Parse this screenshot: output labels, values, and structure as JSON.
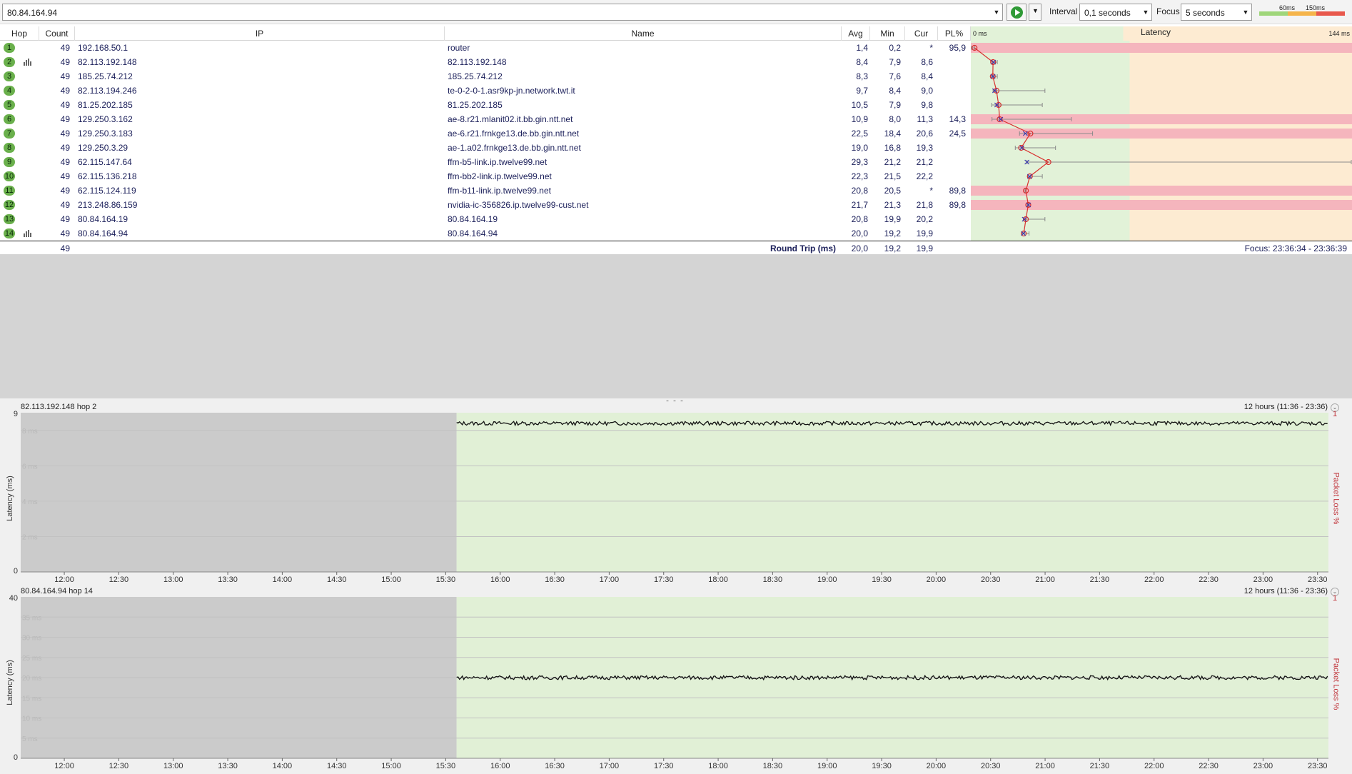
{
  "toolbar": {
    "target": "80.84.164.94",
    "interval_label": "Interval",
    "interval_value": "0,1 seconds",
    "focus_label": "Focus",
    "focus_value": "5 seconds",
    "scale_labels": [
      "60ms",
      "150ms"
    ],
    "colors": {
      "good": "#9fd67a",
      "warn": "#f5b44a",
      "bad": "#e8584c"
    }
  },
  "table": {
    "headers": {
      "hop": "Hop",
      "count": "Count",
      "ip": "IP",
      "name": "Name",
      "avg": "Avg",
      "min": "Min",
      "cur": "Cur",
      "pl": "PL%",
      "latency": "Latency"
    },
    "latency_scale": {
      "min_label": "0 ms",
      "max_label": "144 ms"
    },
    "rows": [
      {
        "hop": "1",
        "count": "49",
        "ip": "192.168.50.1",
        "name": "router",
        "avg": "1,4",
        "min": "0,2",
        "cur": "*",
        "pl": "95,9",
        "graph": false
      },
      {
        "hop": "2",
        "count": "49",
        "ip": "82.113.192.148",
        "name": "82.113.192.148",
        "avg": "8,4",
        "min": "7,9",
        "cur": "8,6",
        "pl": "",
        "graph": true
      },
      {
        "hop": "3",
        "count": "49",
        "ip": "185.25.74.212",
        "name": "185.25.74.212",
        "avg": "8,3",
        "min": "7,6",
        "cur": "8,4",
        "pl": "",
        "graph": false
      },
      {
        "hop": "4",
        "count": "49",
        "ip": "82.113.194.246",
        "name": "te-0-2-0-1.asr9kp-jn.network.twt.it",
        "avg": "9,7",
        "min": "8,4",
        "cur": "9,0",
        "pl": "",
        "graph": false
      },
      {
        "hop": "5",
        "count": "49",
        "ip": "81.25.202.185",
        "name": "81.25.202.185",
        "avg": "10,5",
        "min": "7,9",
        "cur": "9,8",
        "pl": "",
        "graph": false
      },
      {
        "hop": "6",
        "count": "49",
        "ip": "129.250.3.162",
        "name": "ae-8.r21.mlanit02.it.bb.gin.ntt.net",
        "avg": "10,9",
        "min": "8,0",
        "cur": "11,3",
        "pl": "14,3",
        "graph": false
      },
      {
        "hop": "7",
        "count": "49",
        "ip": "129.250.3.183",
        "name": "ae-6.r21.frnkge13.de.bb.gin.ntt.net",
        "avg": "22,5",
        "min": "18,4",
        "cur": "20,6",
        "pl": "24,5",
        "graph": false
      },
      {
        "hop": "8",
        "count": "49",
        "ip": "129.250.3.29",
        "name": "ae-1.a02.frnkge13.de.bb.gin.ntt.net",
        "avg": "19,0",
        "min": "16,8",
        "cur": "19,3",
        "pl": "",
        "graph": false
      },
      {
        "hop": "9",
        "count": "49",
        "ip": "62.115.147.64",
        "name": "ffm-b5-link.ip.twelve99.net",
        "avg": "29,3",
        "min": "21,2",
        "cur": "21,2",
        "pl": "",
        "graph": false
      },
      {
        "hop": "10",
        "count": "49",
        "ip": "62.115.136.218",
        "name": "ffm-bb2-link.ip.twelve99.net",
        "avg": "22,3",
        "min": "21,5",
        "cur": "22,2",
        "pl": "",
        "graph": false
      },
      {
        "hop": "11",
        "count": "49",
        "ip": "62.115.124.119",
        "name": "ffm-b11-link.ip.twelve99.net",
        "avg": "20,8",
        "min": "20,5",
        "cur": "*",
        "pl": "89,8",
        "graph": false
      },
      {
        "hop": "12",
        "count": "49",
        "ip": "213.248.86.159",
        "name": "nvidia-ic-356826.ip.twelve99-cust.net",
        "avg": "21,7",
        "min": "21,3",
        "cur": "21,8",
        "pl": "89,8",
        "graph": false
      },
      {
        "hop": "13",
        "count": "49",
        "ip": "80.84.164.19",
        "name": "80.84.164.19",
        "avg": "20,8",
        "min": "19,9",
        "cur": "20,2",
        "pl": "",
        "graph": false
      },
      {
        "hop": "14",
        "count": "49",
        "ip": "80.84.164.94",
        "name": "80.84.164.94",
        "avg": "20,0",
        "min": "19,2",
        "cur": "19,9",
        "pl": "",
        "graph": true
      }
    ],
    "latency_marks": [
      {
        "avg": 1.4,
        "min": 0.2,
        "max": 1.4,
        "cur": null
      },
      {
        "avg": 8.4,
        "min": 7.9,
        "max": 10,
        "cur": 8.6
      },
      {
        "avg": 8.3,
        "min": 7.6,
        "max": 10,
        "cur": 8.4
      },
      {
        "avg": 9.7,
        "min": 8.4,
        "max": 28,
        "cur": 9.0
      },
      {
        "avg": 10.5,
        "min": 7.9,
        "max": 27,
        "cur": 9.8
      },
      {
        "avg": 10.9,
        "min": 8.0,
        "max": 38,
        "cur": 11.3
      },
      {
        "avg": 22.5,
        "min": 18.4,
        "max": 46,
        "cur": 20.6
      },
      {
        "avg": 19.0,
        "min": 16.8,
        "max": 32,
        "cur": 19.3
      },
      {
        "avg": 29.3,
        "min": 21.2,
        "max": 144,
        "cur": 21.2
      },
      {
        "avg": 22.3,
        "min": 21.5,
        "max": 27,
        "cur": 22.2
      },
      {
        "avg": 20.8,
        "min": 20.5,
        "max": 20.8,
        "cur": null
      },
      {
        "avg": 21.7,
        "min": 21.3,
        "max": 21.7,
        "cur": 21.8
      },
      {
        "avg": 20.8,
        "min": 19.9,
        "max": 28,
        "cur": 20.2
      },
      {
        "avg": 20.0,
        "min": 19.2,
        "max": 22,
        "cur": 19.9
      }
    ],
    "summary": {
      "count": "49",
      "label": "Round Trip (ms)",
      "avg": "20,0",
      "min": "19,2",
      "cur": "19,9",
      "focus": "Focus: 23:36:34 - 23:36:39"
    }
  },
  "graphs": [
    {
      "title": "82.113.192.148 hop 2",
      "range": "12 hours (11:36 - 23:36)",
      "ylabel": "Latency (ms)",
      "pl_label": "Packet Loss %",
      "ymax_label": "9",
      "ymin_label": "0",
      "pl_top": "1",
      "ymax": 9,
      "gridlines": [
        {
          "v": 8,
          "label": "8 ms"
        },
        {
          "v": 6,
          "label": "6 ms"
        },
        {
          "v": 4,
          "label": "4 ms"
        },
        {
          "v": 2,
          "label": "2 ms"
        }
      ],
      "line_value": 8.4,
      "data_start_label": "15:36"
    },
    {
      "title": "80.84.164.94 hop 14",
      "range": "12 hours (11:36 - 23:36)",
      "ylabel": "Latency (ms)",
      "pl_label": "Packet Loss %",
      "ymax_label": "40",
      "ymin_label": "0",
      "pl_top": "1",
      "ymax": 40,
      "gridlines": [
        {
          "v": 35,
          "label": "35 ms"
        },
        {
          "v": 30,
          "label": "30 ms"
        },
        {
          "v": 25,
          "label": "25 ms"
        },
        {
          "v": 20,
          "label": "20 ms"
        },
        {
          "v": 15,
          "label": "15 ms"
        },
        {
          "v": 10,
          "label": "10 ms"
        },
        {
          "v": 5,
          "label": "5 ms"
        }
      ],
      "line_value": 20.0,
      "data_start_label": "15:36"
    }
  ],
  "time_axis": [
    "12:00",
    "12:30",
    "13:00",
    "13:30",
    "14:00",
    "14:30",
    "15:00",
    "15:30",
    "16:00",
    "16:30",
    "17:00",
    "17:30",
    "18:00",
    "18:30",
    "19:00",
    "19:30",
    "20:00",
    "20:30",
    "21:00",
    "21:30",
    "22:00",
    "22:30",
    "23:00",
    "23:30"
  ]
}
